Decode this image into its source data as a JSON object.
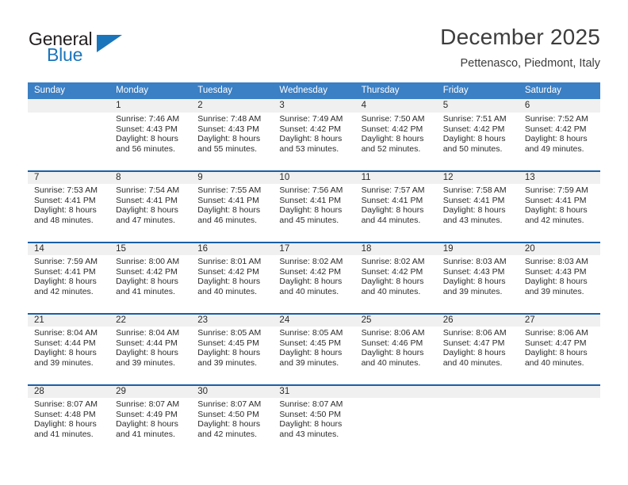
{
  "brand": {
    "name_part1": "General",
    "name_part2": "Blue",
    "flag_icon": "triangle-flag-icon"
  },
  "header": {
    "title": "December 2025",
    "location": "Pettenasco, Piedmont, Italy"
  },
  "calendar": {
    "accent_color": "#3b7fc4",
    "separator_color": "#1a5fa8",
    "day_band_color": "#f0f0f0",
    "weekday_headers": [
      "Sunday",
      "Monday",
      "Tuesday",
      "Wednesday",
      "Thursday",
      "Friday",
      "Saturday"
    ],
    "weeks": [
      [
        {
          "day": "",
          "lines": []
        },
        {
          "day": "1",
          "lines": [
            "Sunrise: 7:46 AM",
            "Sunset: 4:43 PM",
            "Daylight: 8 hours",
            "and 56 minutes."
          ]
        },
        {
          "day": "2",
          "lines": [
            "Sunrise: 7:48 AM",
            "Sunset: 4:43 PM",
            "Daylight: 8 hours",
            "and 55 minutes."
          ]
        },
        {
          "day": "3",
          "lines": [
            "Sunrise: 7:49 AM",
            "Sunset: 4:42 PM",
            "Daylight: 8 hours",
            "and 53 minutes."
          ]
        },
        {
          "day": "4",
          "lines": [
            "Sunrise: 7:50 AM",
            "Sunset: 4:42 PM",
            "Daylight: 8 hours",
            "and 52 minutes."
          ]
        },
        {
          "day": "5",
          "lines": [
            "Sunrise: 7:51 AM",
            "Sunset: 4:42 PM",
            "Daylight: 8 hours",
            "and 50 minutes."
          ]
        },
        {
          "day": "6",
          "lines": [
            "Sunrise: 7:52 AM",
            "Sunset: 4:42 PM",
            "Daylight: 8 hours",
            "and 49 minutes."
          ]
        }
      ],
      [
        {
          "day": "7",
          "lines": [
            "Sunrise: 7:53 AM",
            "Sunset: 4:41 PM",
            "Daylight: 8 hours",
            "and 48 minutes."
          ]
        },
        {
          "day": "8",
          "lines": [
            "Sunrise: 7:54 AM",
            "Sunset: 4:41 PM",
            "Daylight: 8 hours",
            "and 47 minutes."
          ]
        },
        {
          "day": "9",
          "lines": [
            "Sunrise: 7:55 AM",
            "Sunset: 4:41 PM",
            "Daylight: 8 hours",
            "and 46 minutes."
          ]
        },
        {
          "day": "10",
          "lines": [
            "Sunrise: 7:56 AM",
            "Sunset: 4:41 PM",
            "Daylight: 8 hours",
            "and 45 minutes."
          ]
        },
        {
          "day": "11",
          "lines": [
            "Sunrise: 7:57 AM",
            "Sunset: 4:41 PM",
            "Daylight: 8 hours",
            "and 44 minutes."
          ]
        },
        {
          "day": "12",
          "lines": [
            "Sunrise: 7:58 AM",
            "Sunset: 4:41 PM",
            "Daylight: 8 hours",
            "and 43 minutes."
          ]
        },
        {
          "day": "13",
          "lines": [
            "Sunrise: 7:59 AM",
            "Sunset: 4:41 PM",
            "Daylight: 8 hours",
            "and 42 minutes."
          ]
        }
      ],
      [
        {
          "day": "14",
          "lines": [
            "Sunrise: 7:59 AM",
            "Sunset: 4:41 PM",
            "Daylight: 8 hours",
            "and 42 minutes."
          ]
        },
        {
          "day": "15",
          "lines": [
            "Sunrise: 8:00 AM",
            "Sunset: 4:42 PM",
            "Daylight: 8 hours",
            "and 41 minutes."
          ]
        },
        {
          "day": "16",
          "lines": [
            "Sunrise: 8:01 AM",
            "Sunset: 4:42 PM",
            "Daylight: 8 hours",
            "and 40 minutes."
          ]
        },
        {
          "day": "17",
          "lines": [
            "Sunrise: 8:02 AM",
            "Sunset: 4:42 PM",
            "Daylight: 8 hours",
            "and 40 minutes."
          ]
        },
        {
          "day": "18",
          "lines": [
            "Sunrise: 8:02 AM",
            "Sunset: 4:42 PM",
            "Daylight: 8 hours",
            "and 40 minutes."
          ]
        },
        {
          "day": "19",
          "lines": [
            "Sunrise: 8:03 AM",
            "Sunset: 4:43 PM",
            "Daylight: 8 hours",
            "and 39 minutes."
          ]
        },
        {
          "day": "20",
          "lines": [
            "Sunrise: 8:03 AM",
            "Sunset: 4:43 PM",
            "Daylight: 8 hours",
            "and 39 minutes."
          ]
        }
      ],
      [
        {
          "day": "21",
          "lines": [
            "Sunrise: 8:04 AM",
            "Sunset: 4:44 PM",
            "Daylight: 8 hours",
            "and 39 minutes."
          ]
        },
        {
          "day": "22",
          "lines": [
            "Sunrise: 8:04 AM",
            "Sunset: 4:44 PM",
            "Daylight: 8 hours",
            "and 39 minutes."
          ]
        },
        {
          "day": "23",
          "lines": [
            "Sunrise: 8:05 AM",
            "Sunset: 4:45 PM",
            "Daylight: 8 hours",
            "and 39 minutes."
          ]
        },
        {
          "day": "24",
          "lines": [
            "Sunrise: 8:05 AM",
            "Sunset: 4:45 PM",
            "Daylight: 8 hours",
            "and 39 minutes."
          ]
        },
        {
          "day": "25",
          "lines": [
            "Sunrise: 8:06 AM",
            "Sunset: 4:46 PM",
            "Daylight: 8 hours",
            "and 40 minutes."
          ]
        },
        {
          "day": "26",
          "lines": [
            "Sunrise: 8:06 AM",
            "Sunset: 4:47 PM",
            "Daylight: 8 hours",
            "and 40 minutes."
          ]
        },
        {
          "day": "27",
          "lines": [
            "Sunrise: 8:06 AM",
            "Sunset: 4:47 PM",
            "Daylight: 8 hours",
            "and 40 minutes."
          ]
        }
      ],
      [
        {
          "day": "28",
          "lines": [
            "Sunrise: 8:07 AM",
            "Sunset: 4:48 PM",
            "Daylight: 8 hours",
            "and 41 minutes."
          ]
        },
        {
          "day": "29",
          "lines": [
            "Sunrise: 8:07 AM",
            "Sunset: 4:49 PM",
            "Daylight: 8 hours",
            "and 41 minutes."
          ]
        },
        {
          "day": "30",
          "lines": [
            "Sunrise: 8:07 AM",
            "Sunset: 4:50 PM",
            "Daylight: 8 hours",
            "and 42 minutes."
          ]
        },
        {
          "day": "31",
          "lines": [
            "Sunrise: 8:07 AM",
            "Sunset: 4:50 PM",
            "Daylight: 8 hours",
            "and 43 minutes."
          ]
        },
        {
          "day": "",
          "lines": []
        },
        {
          "day": "",
          "lines": []
        },
        {
          "day": "",
          "lines": []
        }
      ]
    ]
  }
}
